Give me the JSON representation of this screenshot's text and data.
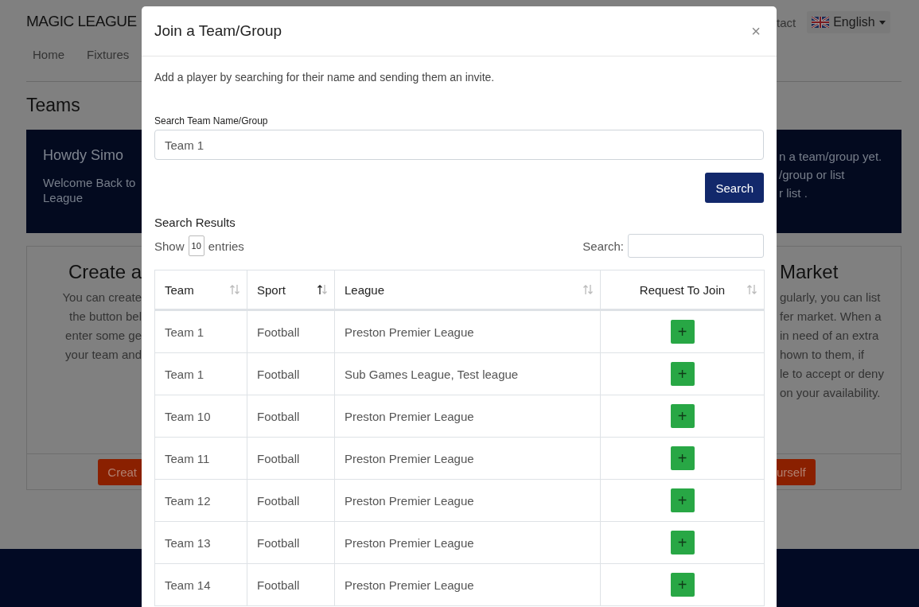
{
  "background": {
    "logo": "MAGIC LEAGUE",
    "nav": [
      "Home",
      "Fixtures"
    ],
    "nav_right": "tact",
    "language": "English",
    "page_title": "Teams",
    "banner_left": {
      "title": "Howdy Simo",
      "text": [
        "Welcome Back to",
        "League"
      ]
    },
    "banner_right": {
      "text": [
        "n a team/group yet.",
        "/group or list",
        "r list ."
      ]
    },
    "card_left": {
      "title": "Create a",
      "text": [
        "You can create",
        "the button bel",
        "enter some ge",
        "your team and"
      ],
      "button": "Creat"
    },
    "card_right": {
      "title": "Market",
      "text": [
        "gularly, you can list",
        "fer market. When a",
        "in need of an extra",
        "hown to them, if",
        "le to accept or deny",
        "on your availability."
      ],
      "button": "urself"
    }
  },
  "modal": {
    "title": "Join a Team/Group",
    "close": "×",
    "description": "Add a player by searching for their name and sending them an invite.",
    "search_label": "Search Team Name/Group",
    "search_value": "Team 1",
    "search_button": "Search",
    "results_title": "Search Results",
    "show_label": "Show",
    "page_size": "10",
    "entries_label": "entries",
    "filter_label": "Search:",
    "columns": [
      {
        "label": "Team",
        "sorted": false
      },
      {
        "label": "Sport",
        "sorted": true
      },
      {
        "label": "League",
        "sorted": false
      },
      {
        "label": "Request To Join",
        "sorted": false
      }
    ],
    "join_icon": "+",
    "rows": [
      {
        "team": "Team 1",
        "sport": "Football",
        "league": "Preston Premier League"
      },
      {
        "team": "Team 1",
        "sport": "Football",
        "league": "Sub Games League, Test league"
      },
      {
        "team": "Team 10",
        "sport": "Football",
        "league": "Preston Premier League"
      },
      {
        "team": "Team 11",
        "sport": "Football",
        "league": "Preston Premier League"
      },
      {
        "team": "Team 12",
        "sport": "Football",
        "league": "Preston Premier League"
      },
      {
        "team": "Team 13",
        "sport": "Football",
        "league": "Preston Premier League"
      },
      {
        "team": "Team 14",
        "sport": "Football",
        "league": "Preston Premier League"
      }
    ]
  }
}
